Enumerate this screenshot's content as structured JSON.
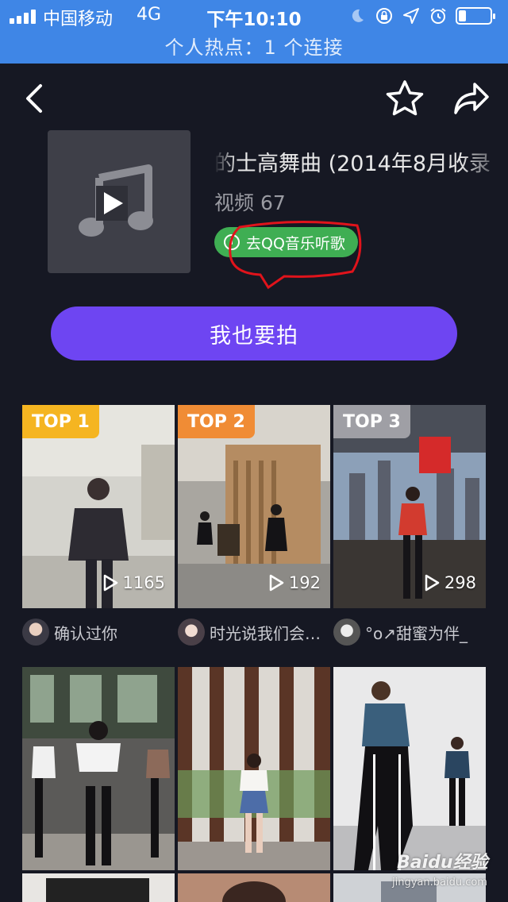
{
  "status_bar": {
    "carrier": "中国移动",
    "network": "4G",
    "time": "下午10:10",
    "hotspot": "个人热点：1 个连接",
    "icons": [
      "moon-icon",
      "rotation-lock-icon",
      "location-icon",
      "alarm-icon",
      "battery-icon"
    ]
  },
  "nav": {
    "back_icon": "chevron-left-icon",
    "favorite_icon": "star-outline-icon",
    "share_icon": "share-arrow-icon"
  },
  "music": {
    "title": "的士高舞曲 (2014年8月收录",
    "video_label": "视频",
    "video_count": "67",
    "qq_button": "去QQ音乐听歌",
    "cover_icon": "music-note-play-icon"
  },
  "shoot_button": "我也要拍",
  "top_videos": [
    {
      "badge": "TOP 1",
      "badge_color": "#f5b521",
      "plays": "1165",
      "author": "确认过你"
    },
    {
      "badge": "TOP 2",
      "badge_color": "#f08c35",
      "plays": "192",
      "author": "时光说我们会…"
    },
    {
      "badge": "TOP 3",
      "badge_color": "#9f9fa5",
      "plays": "298",
      "author": "°o↗甜蜜为伴_"
    }
  ],
  "colors": {
    "background": "#161823",
    "status_bar": "#3f86e6",
    "accent_purple": "#6e45f2",
    "qq_green": "#3fae53",
    "annotation_red": "#e0131b"
  },
  "watermark": {
    "main": "Baidu经验",
    "sub": "jingyan.baidu.com"
  }
}
